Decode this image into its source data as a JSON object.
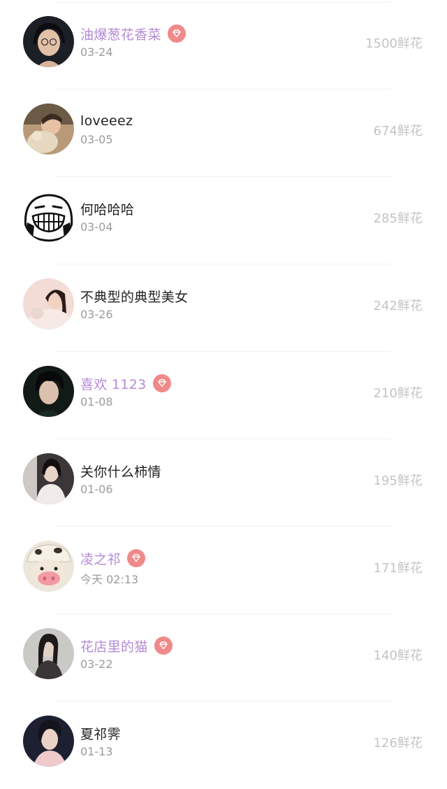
{
  "colors": {
    "vip_name": "#b48ad6",
    "normal_name": "#222222",
    "date": "#9b9b9b",
    "flowers": "#c4c4c4",
    "vip_badge": "#f08a8a"
  },
  "rows": [
    {
      "name": "油爆葱花香菜",
      "vip": true,
      "date": "03-24",
      "count": "1500",
      "unit": "鲜花",
      "avatar_icon": "avatar-photo-woman-glasses"
    },
    {
      "name": "loveeez",
      "vip": false,
      "date": "03-05",
      "count": "674",
      "unit": "鲜花",
      "avatar_icon": "avatar-photo-child-plush"
    },
    {
      "name": "何哈哈哈",
      "vip": false,
      "date": "03-04",
      "count": "285",
      "unit": "鲜花",
      "avatar_icon": "avatar-grin-meme"
    },
    {
      "name": "不典型的典型美女",
      "vip": false,
      "date": "03-26",
      "count": "242",
      "unit": "鲜花",
      "avatar_icon": "avatar-photo-woman-pink"
    },
    {
      "name": "喜欢 1123",
      "vip": true,
      "date": "01-08",
      "count": "210",
      "unit": "鲜花",
      "avatar_icon": "avatar-photo-man-dark"
    },
    {
      "name": "关你什么柿情",
      "vip": false,
      "date": "01-06",
      "count": "195",
      "unit": "鲜花",
      "avatar_icon": "avatar-photo-woman-white"
    },
    {
      "name": "凌之祁",
      "vip": true,
      "date": "今天 02:13",
      "count": "171",
      "unit": "鲜花",
      "avatar_icon": "avatar-cartoon-pig-hat"
    },
    {
      "name": "花店里的猫",
      "vip": true,
      "date": "03-22",
      "count": "140",
      "unit": "鲜花",
      "avatar_icon": "avatar-photo-woman-gray"
    },
    {
      "name": "夏祁霁",
      "vip": false,
      "date": "01-13",
      "count": "126",
      "unit": "鲜花",
      "avatar_icon": "avatar-photo-man-pink"
    }
  ]
}
